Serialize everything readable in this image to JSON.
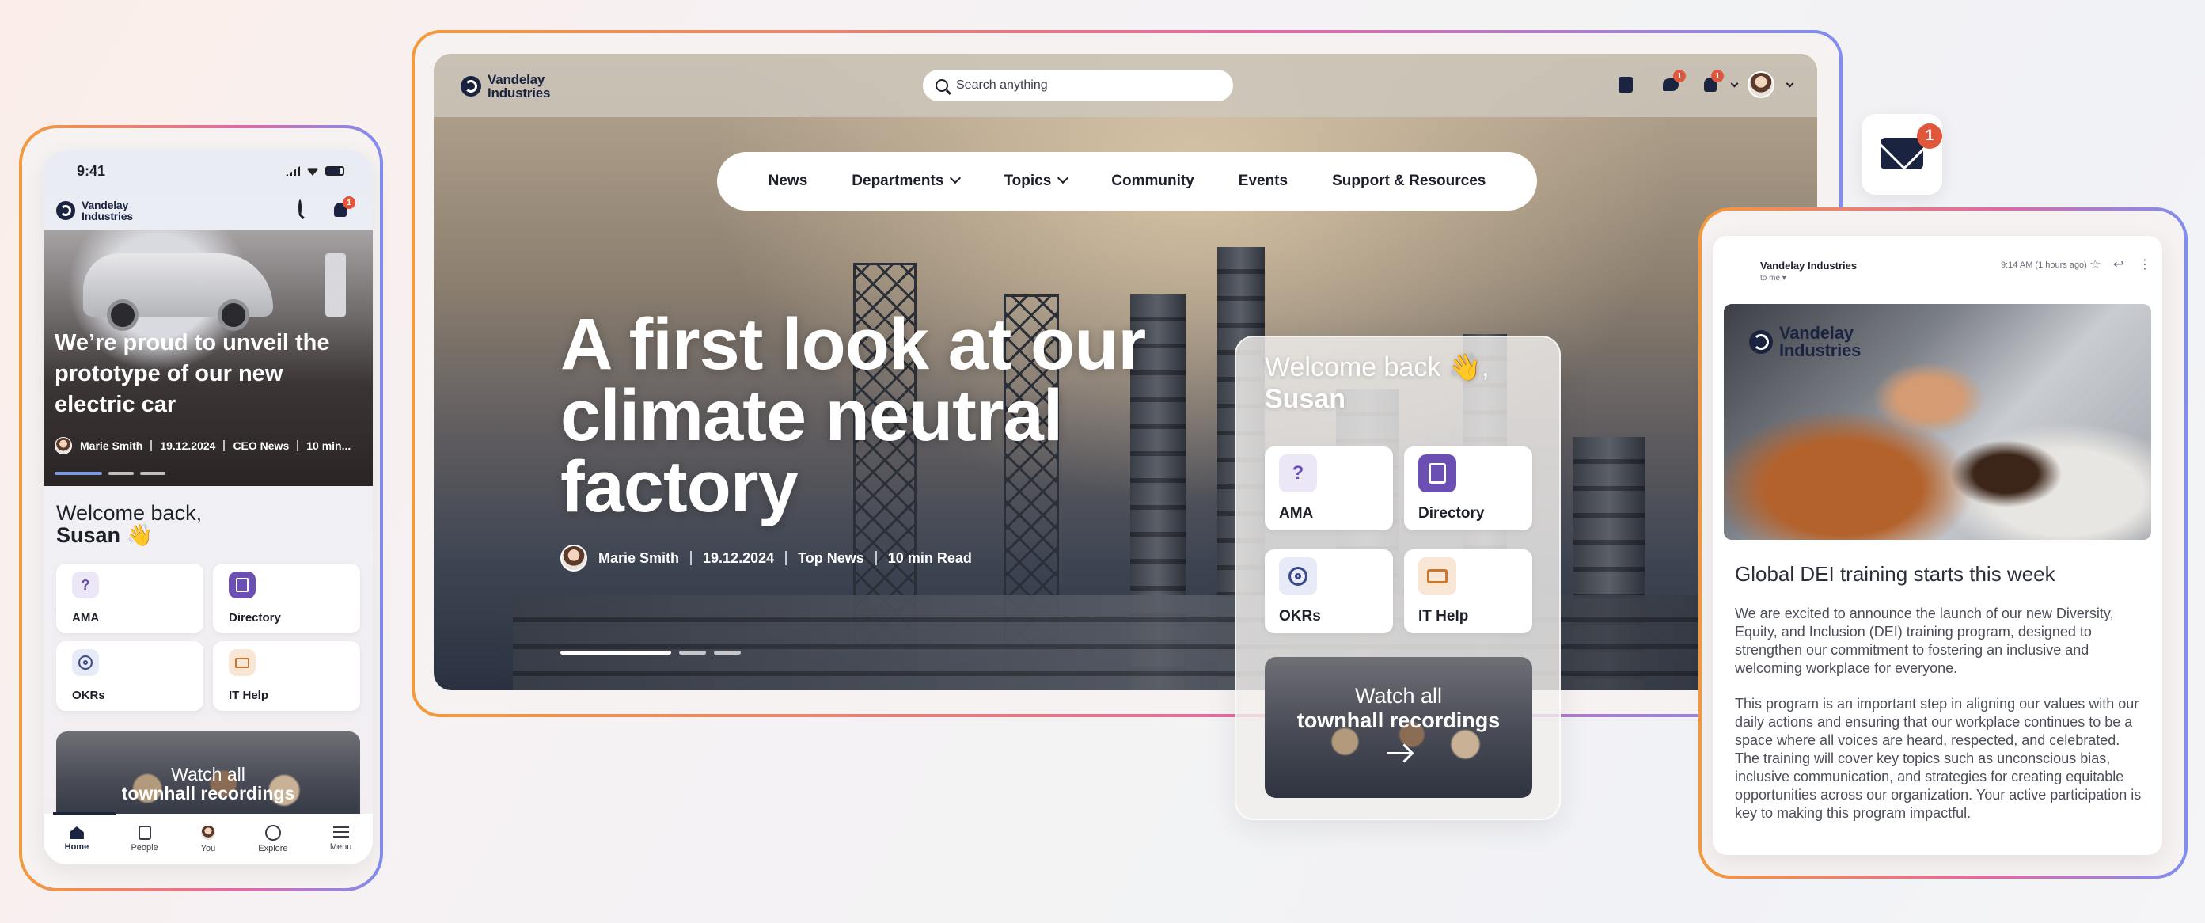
{
  "brand": {
    "name_line1": "Vandelay",
    "name_line2": "Industries"
  },
  "desktop": {
    "search_placeholder": "Search anything",
    "badges": {
      "chat": "1",
      "bell": "1"
    },
    "nav": [
      "News",
      "Departments",
      "Topics",
      "Community",
      "Events",
      "Support & Resources"
    ],
    "hero": {
      "title_line1": "A first look at our",
      "title_line2": "climate neutral",
      "title_line3": "factory",
      "author": "Marie Smith",
      "date": "19.12.2024",
      "category": "Top News",
      "read_time": "10 min Read"
    },
    "welcome": {
      "greeting": "Welcome back 👋,",
      "name": "Susan",
      "tiles": [
        "AMA",
        "Directory",
        "OKRs",
        "IT Help"
      ],
      "watch_line1": "Watch all",
      "watch_line2": "townhall recordings"
    }
  },
  "mobile": {
    "time": "9:41",
    "bell_badge": "1",
    "hero": {
      "title_line1": "We’re proud to unveil the",
      "title_line2": "prototype of our new",
      "title_line3": "electric car",
      "author": "Marie Smith",
      "date": "19.12.2024",
      "category": "CEO News",
      "read_time": "10 min..."
    },
    "welcome_line1": "Welcome back,",
    "welcome_name": "Susan 👋",
    "tiles": [
      "AMA",
      "Directory",
      "OKRs",
      "IT Help"
    ],
    "watch_line1": "Watch all",
    "watch_line2": "townhall recordings",
    "tabbar": [
      "Home",
      "People",
      "You",
      "Explore",
      "Menu"
    ]
  },
  "email": {
    "sender": "Vandelay Industries",
    "to": "to me ▾",
    "time": "9:14 AM (1 hours ago)",
    "subject": "Global DEI training starts this week",
    "para1": "We are excited to announce the launch of our new Diversity, Equity, and Inclusion (DEI) training program, designed to strengthen our commitment to fostering an inclusive and welcoming workplace for everyone.",
    "para2": "This program is an important step in aligning our values with our daily actions and ensuring that our workplace continues to be a space where all voices are heard, respected, and celebrated. The training will cover key topics such as unconscious bias, inclusive communication, and strategies for creating equitable opportunities across our organization. Your active participation is key to making this program impactful."
  },
  "mail_badge": "1",
  "colors": {
    "brand_navy": "#1a2340",
    "badge_red": "#e0573b",
    "tile_purple": "#6b4fb3",
    "tile_orange": "#c9772f"
  }
}
